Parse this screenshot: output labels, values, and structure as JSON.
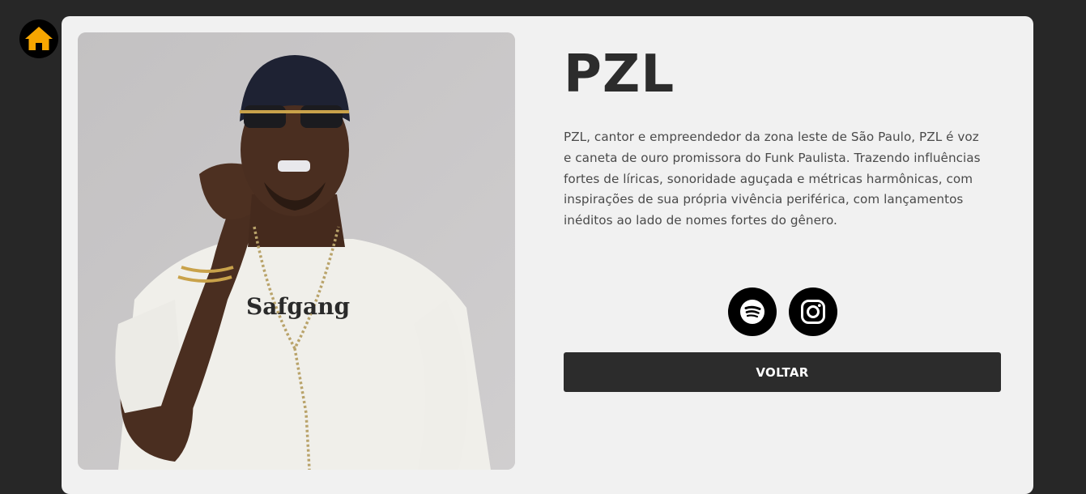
{
  "nav": {
    "home_icon": "home-icon",
    "home_icon_color": "#f7a600"
  },
  "artist": {
    "name": "PZL",
    "photo_alt": "PZL",
    "bio_lines": [
      "PZL, cantor e empreendedor da zona leste de São Paulo, PZL é voz",
      "e caneta de ouro promissora do Funk Paulista. Trazendo influências",
      "fortes de líricas, sonoridade aguçada e métricas harmônicas, com",
      "inspirações de sua própria vivência periférica, com lançamentos",
      "inéditos ao lado de nomes fortes do gênero."
    ]
  },
  "socials": [
    {
      "icon": "spotify-icon"
    },
    {
      "icon": "instagram-icon"
    }
  ],
  "actions": {
    "back_label": "VOLTAR"
  },
  "colors": {
    "page_background": "#272727",
    "card_background": "#f1f1f1",
    "button_background": "#2c2c2c",
    "accent": "#f7a600"
  }
}
